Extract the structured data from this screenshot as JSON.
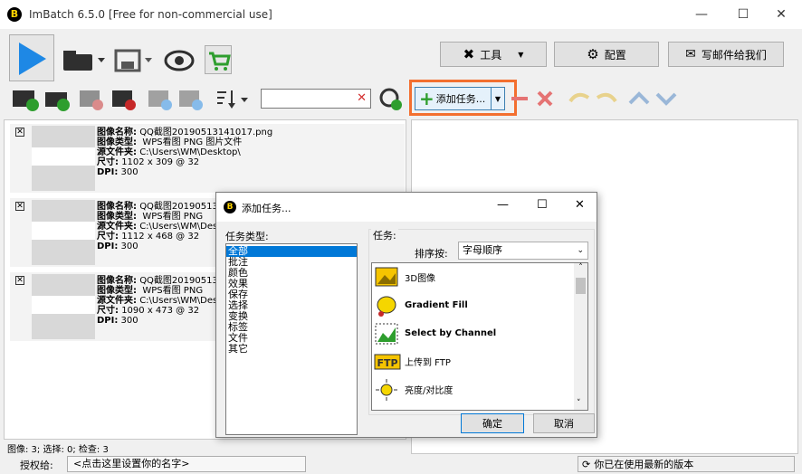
{
  "titlebar": {
    "title": "ImBatch 6.5.0 [Free for non-commercial use]"
  },
  "toolbar": {
    "tools_label": "工具",
    "config_label": "配置",
    "email_label": "写邮件给我们",
    "add_task_label": "添加任务..."
  },
  "images": [
    {
      "name_label": "图像名称:",
      "name": "QQ截图20190513141017.png",
      "type_label": "图像类型:",
      "type": "WPS看图 PNG 图片文件",
      "folder_label": "源文件夹:",
      "folder": "C:\\Users\\WM\\Desktop\\",
      "size_label": "尺寸:",
      "size": "1102 x 309 @ 32",
      "dpi_label": "DPI:",
      "dpi": "300"
    },
    {
      "name_label": "图像名称:",
      "name": "QQ截图20190513",
      "type_label": "图像类型:",
      "type": "WPS看图 PNG",
      "folder_label": "源文件夹:",
      "folder": "C:\\Users\\WM\\Des",
      "size_label": "尺寸:",
      "size": "1112 x 468 @ 32",
      "dpi_label": "DPI:",
      "dpi": "300"
    },
    {
      "name_label": "图像名称:",
      "name": "QQ截图20190513",
      "type_label": "图像类型:",
      "type": "WPS看图 PNG",
      "folder_label": "源文件夹:",
      "folder": "C:\\Users\\WM\\Des",
      "size_label": "尺寸:",
      "size": "1090 x 473 @ 32",
      "dpi_label": "DPI:",
      "dpi": "300"
    }
  ],
  "status": {
    "counts": "图像: 3; 选择: 0; 检查: 3",
    "license_label": "授权给:",
    "license_value": "<点击这里设置你的名字>",
    "version": "你已在使用最新的版本"
  },
  "dialog": {
    "title": "添加任务...",
    "categories_label": "任务类型:",
    "categories": [
      "全部",
      "批注",
      "颜色",
      "效果",
      "保存",
      "选择",
      "变换",
      "标签",
      "文件",
      "其它"
    ],
    "tasks_label": "任务:",
    "sort_label": "排序按:",
    "sort_value": "字母顺序",
    "tasks": [
      "3D图像",
      "Gradient Fill",
      "Select by Channel",
      "上传到 FTP",
      "亮度/对比度"
    ],
    "ok_label": "确定",
    "cancel_label": "取消"
  },
  "colors": {
    "accent": "#1e88e5",
    "green": "#2e9e2e",
    "highlight_border": "#f36f2f",
    "selection": "#0078d7"
  }
}
